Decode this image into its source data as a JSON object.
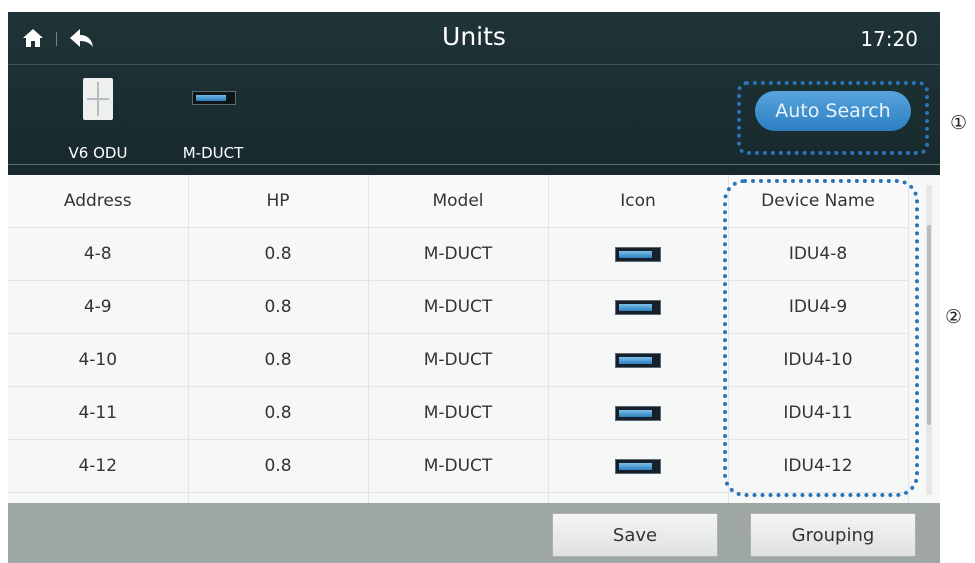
{
  "header": {
    "title": "Units",
    "clock": "17:20"
  },
  "device_types": [
    {
      "label": "V6 ODU",
      "icon": "outdoor-unit-icon"
    },
    {
      "label": "M-DUCT",
      "icon": "duct-unit-icon"
    }
  ],
  "actions": {
    "auto_search": "Auto Search",
    "save": "Save",
    "grouping": "Grouping"
  },
  "table": {
    "columns": [
      "Address",
      "HP",
      "Model",
      "Icon",
      "Device Name"
    ],
    "rows": [
      {
        "address": "4-8",
        "hp": "0.8",
        "model": "M-DUCT",
        "icon": "duct-unit-icon",
        "device_name": "IDU4-8"
      },
      {
        "address": "4-9",
        "hp": "0.8",
        "model": "M-DUCT",
        "icon": "duct-unit-icon",
        "device_name": "IDU4-9"
      },
      {
        "address": "4-10",
        "hp": "0.8",
        "model": "M-DUCT",
        "icon": "duct-unit-icon",
        "device_name": "IDU4-10"
      },
      {
        "address": "4-11",
        "hp": "0.8",
        "model": "M-DUCT",
        "icon": "duct-unit-icon",
        "device_name": "IDU4-11"
      },
      {
        "address": "4-12",
        "hp": "0.8",
        "model": "M-DUCT",
        "icon": "duct-unit-icon",
        "device_name": "IDU4-12"
      }
    ]
  },
  "annotations": {
    "callout_1": "①",
    "callout_2": "②"
  },
  "colors": {
    "header_bg": "#1b2e31",
    "accent": "#3d8fd0",
    "footer_bg": "#9ea7a4",
    "annotation": "#2a74b8"
  }
}
